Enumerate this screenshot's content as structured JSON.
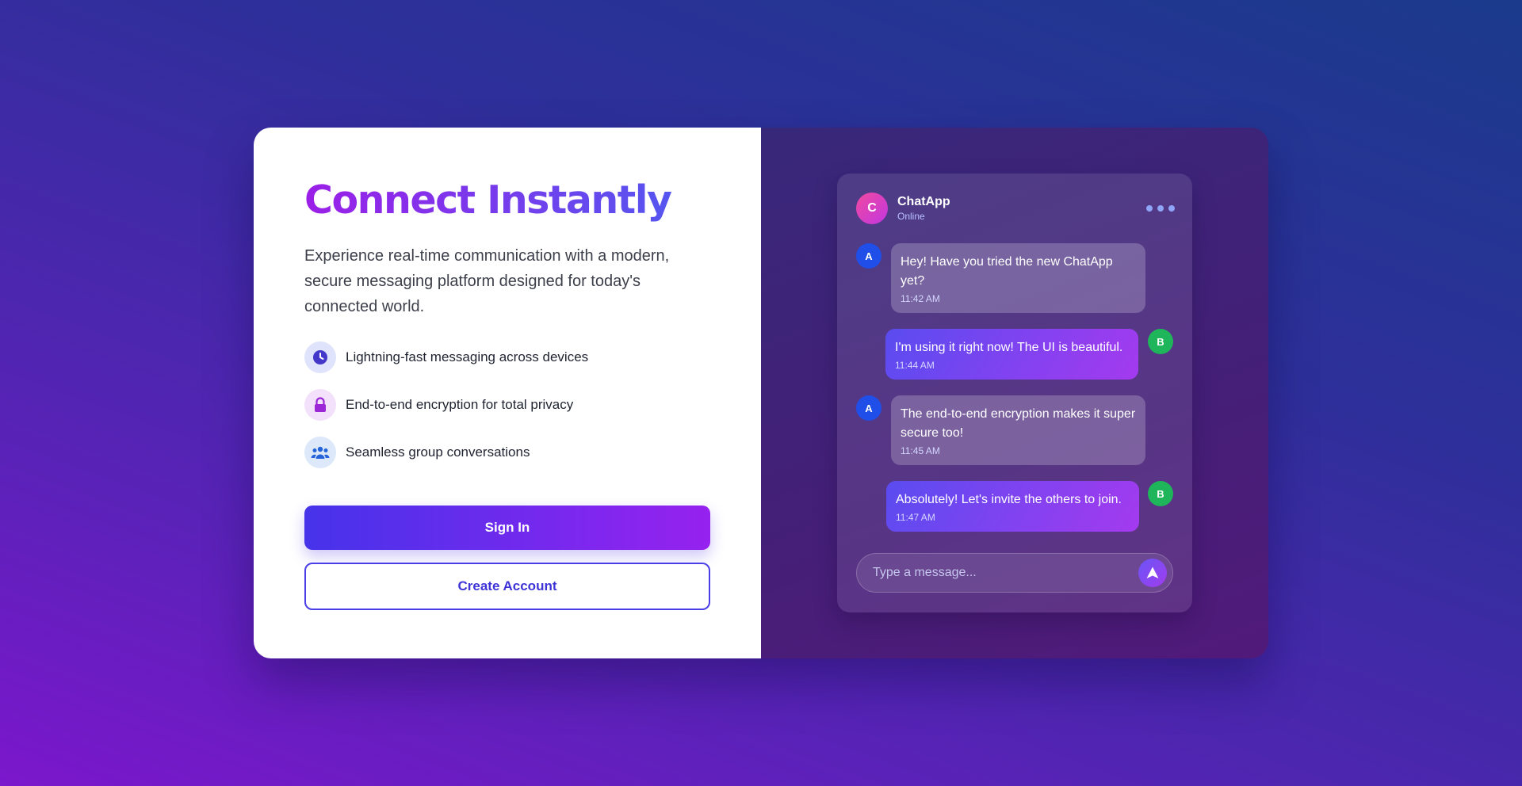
{
  "hero": {
    "headline": "Connect Instantly",
    "description": "Experience real-time communication with a modern, secure messaging platform designed for today's connected world."
  },
  "features": [
    {
      "icon": "clock-icon",
      "text": "Lightning-fast messaging across devices"
    },
    {
      "icon": "lock-icon",
      "text": "End-to-end encryption for total privacy"
    },
    {
      "icon": "users-icon",
      "text": "Seamless group conversations"
    }
  ],
  "actions": {
    "sign_in": "Sign In",
    "create_account": "Create Account"
  },
  "chat": {
    "avatar_letter": "C",
    "name": "ChatApp",
    "status": "Online",
    "messages": [
      {
        "sender": "A",
        "direction": "incoming",
        "text": "Hey! Have you tried the new ChatApp yet?",
        "time": "11:42 AM"
      },
      {
        "sender": "B",
        "direction": "outgoing",
        "text": "I'm using it right now! The UI is beautiful.",
        "time": "11:44 AM"
      },
      {
        "sender": "A",
        "direction": "incoming",
        "text": "The end-to-end encryption makes it super secure too!",
        "time": "11:45 AM"
      },
      {
        "sender": "B",
        "direction": "outgoing",
        "text": "Absolutely! Let's invite the others to join.",
        "time": "11:47 AM"
      }
    ],
    "composer_placeholder": "Type a message..."
  },
  "colors": {
    "accent_start": "#4633ea",
    "accent_end": "#9622ef",
    "avatar_a": "#1f4fe8",
    "avatar_b": "#1fb55a"
  }
}
